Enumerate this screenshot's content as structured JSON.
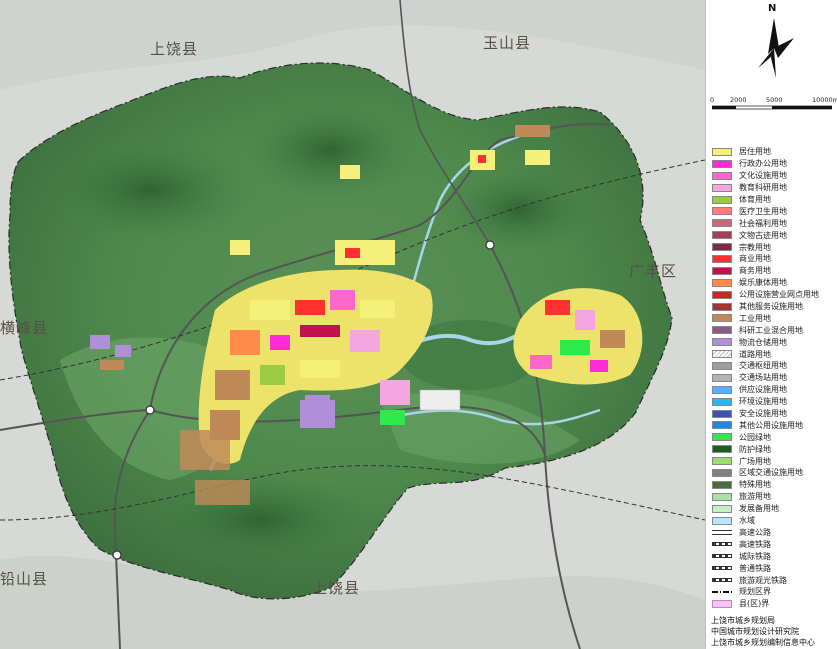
{
  "place_labels": {
    "shangrao_county_north": "上饶县",
    "yushan_county": "玉山县",
    "guangfeng_district": "广丰区",
    "hengfeng_county": "横峰县",
    "qianshan_county": "铅山县",
    "shangrao_county_south": "上饶县"
  },
  "north_arrow": {
    "label": "N"
  },
  "scale_bar": {
    "ticks": [
      "0",
      "2000",
      "5000",
      "10000m"
    ]
  },
  "legend": [
    {
      "label": "居住用地",
      "color": "#f5f07a"
    },
    {
      "label": "行政办公用地",
      "color": "#ff2bd8"
    },
    {
      "label": "文化设施用地",
      "color": "#ff66cc"
    },
    {
      "label": "教育科研用地",
      "color": "#f4a6e0"
    },
    {
      "label": "体育用地",
      "color": "#9ccc46"
    },
    {
      "label": "医疗卫生用地",
      "color": "#ff7c7c"
    },
    {
      "label": "社会福利用地",
      "color": "#c46b73"
    },
    {
      "label": "文物古迹用地",
      "color": "#a0405a"
    },
    {
      "label": "宗教用地",
      "color": "#7e2a40"
    },
    {
      "label": "商业用地",
      "color": "#ff3030"
    },
    {
      "label": "商务用地",
      "color": "#c0134d"
    },
    {
      "label": "娱乐康体用地",
      "color": "#ff8a4a"
    },
    {
      "label": "公用设施营业网点用地",
      "color": "#c62828"
    },
    {
      "label": "其他服务设施用地",
      "color": "#a1342d"
    },
    {
      "label": "工业用地",
      "color": "#c08a58"
    },
    {
      "label": "科研工业混合用地",
      "color": "#8b5a80"
    },
    {
      "label": "物流仓储用地",
      "color": "#b08ed8"
    },
    {
      "label": "道路用地",
      "color": "#ffffff",
      "style": "hatch"
    },
    {
      "label": "交通枢纽用地",
      "color": "#9e9e9e"
    },
    {
      "label": "交通场站用地",
      "color": "#b4b4b4"
    },
    {
      "label": "供应设施用地",
      "color": "#5ab0ff"
    },
    {
      "label": "环境设施用地",
      "color": "#29b6f6"
    },
    {
      "label": "安全设施用地",
      "color": "#3f51b5"
    },
    {
      "label": "其他公用设施用地",
      "color": "#1e88e5"
    },
    {
      "label": "公园绿地",
      "color": "#2ee84c"
    },
    {
      "label": "防护绿地",
      "color": "#1b5e20"
    },
    {
      "label": "广场用地",
      "color": "#98df6e"
    },
    {
      "label": "区域交通设施用地",
      "color": "#808080"
    },
    {
      "label": "特殊用地",
      "color": "#4e6b3e"
    },
    {
      "label": "旅游用地",
      "color": "#a6e5a6"
    },
    {
      "label": "发展备用地",
      "color": "#c6efc6"
    },
    {
      "label": "水域",
      "color": "#b7e7f7"
    },
    {
      "label": "高速公路",
      "color": "#ffffff",
      "style": "double-line"
    },
    {
      "label": "高速铁路",
      "color": "#ffffff",
      "style": "dash"
    },
    {
      "label": "城际铁路",
      "color": "#ffffff",
      "style": "dash"
    },
    {
      "label": "普通铁路",
      "color": "#ffffff",
      "style": "dash"
    },
    {
      "label": "旅游观光铁路",
      "color": "#ffffff",
      "style": "dash"
    },
    {
      "label": "规划区界",
      "color": "#ffffff",
      "style": "dash-dot"
    },
    {
      "label": "县(区)界",
      "color": "#f2c6f0",
      "style": "outline"
    }
  ],
  "credits": {
    "line1": "上饶市城乡规划局",
    "line2": "中国城市规划设计研究院",
    "line3": "上饶市城乡规划编制信息中心"
  }
}
